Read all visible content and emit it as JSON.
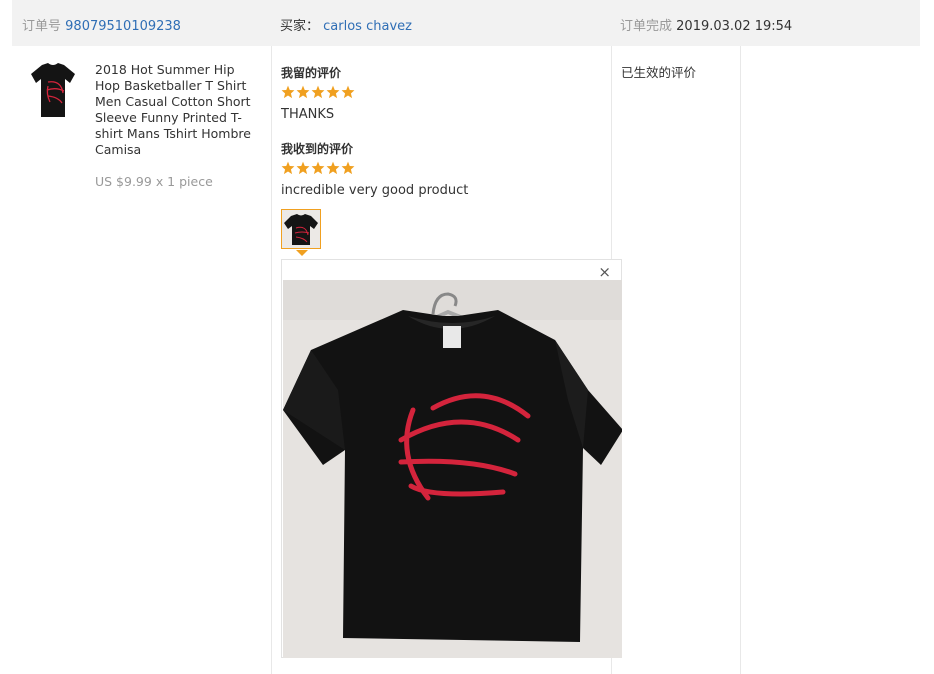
{
  "header": {
    "order_label": "订单号",
    "order_number": "98079510109238",
    "buyer_label": "买家：",
    "buyer_name": "carlos chavez",
    "completed_label": "订单完成",
    "completed_time": "2019.03.02 19:54"
  },
  "product": {
    "title": "2018 Hot Summer Hip Hop Basketballer T Shirt Men Casual Cotton Short Sleeve Funny Printed T-shirt Mans Tshirt Hombre Camisa",
    "price_line": "US $9.99 x 1 piece",
    "image_icon": "tshirt-thumbnail"
  },
  "my_review": {
    "heading": "我留的评价",
    "rating": 5,
    "max_rating": 5,
    "text": "THANKS"
  },
  "received_review": {
    "heading": "我收到的评价",
    "rating": 5,
    "max_rating": 5,
    "text": "incredible very good product"
  },
  "preview": {
    "close_symbol": "×"
  },
  "status": {
    "text": "已生效的评价"
  },
  "colors": {
    "header_bg": "#f2f2f2",
    "link": "#2f6eb5",
    "muted": "#999999",
    "star": "#f0a020",
    "shirt": "#141414",
    "basketball_lines": "#d4243c"
  }
}
